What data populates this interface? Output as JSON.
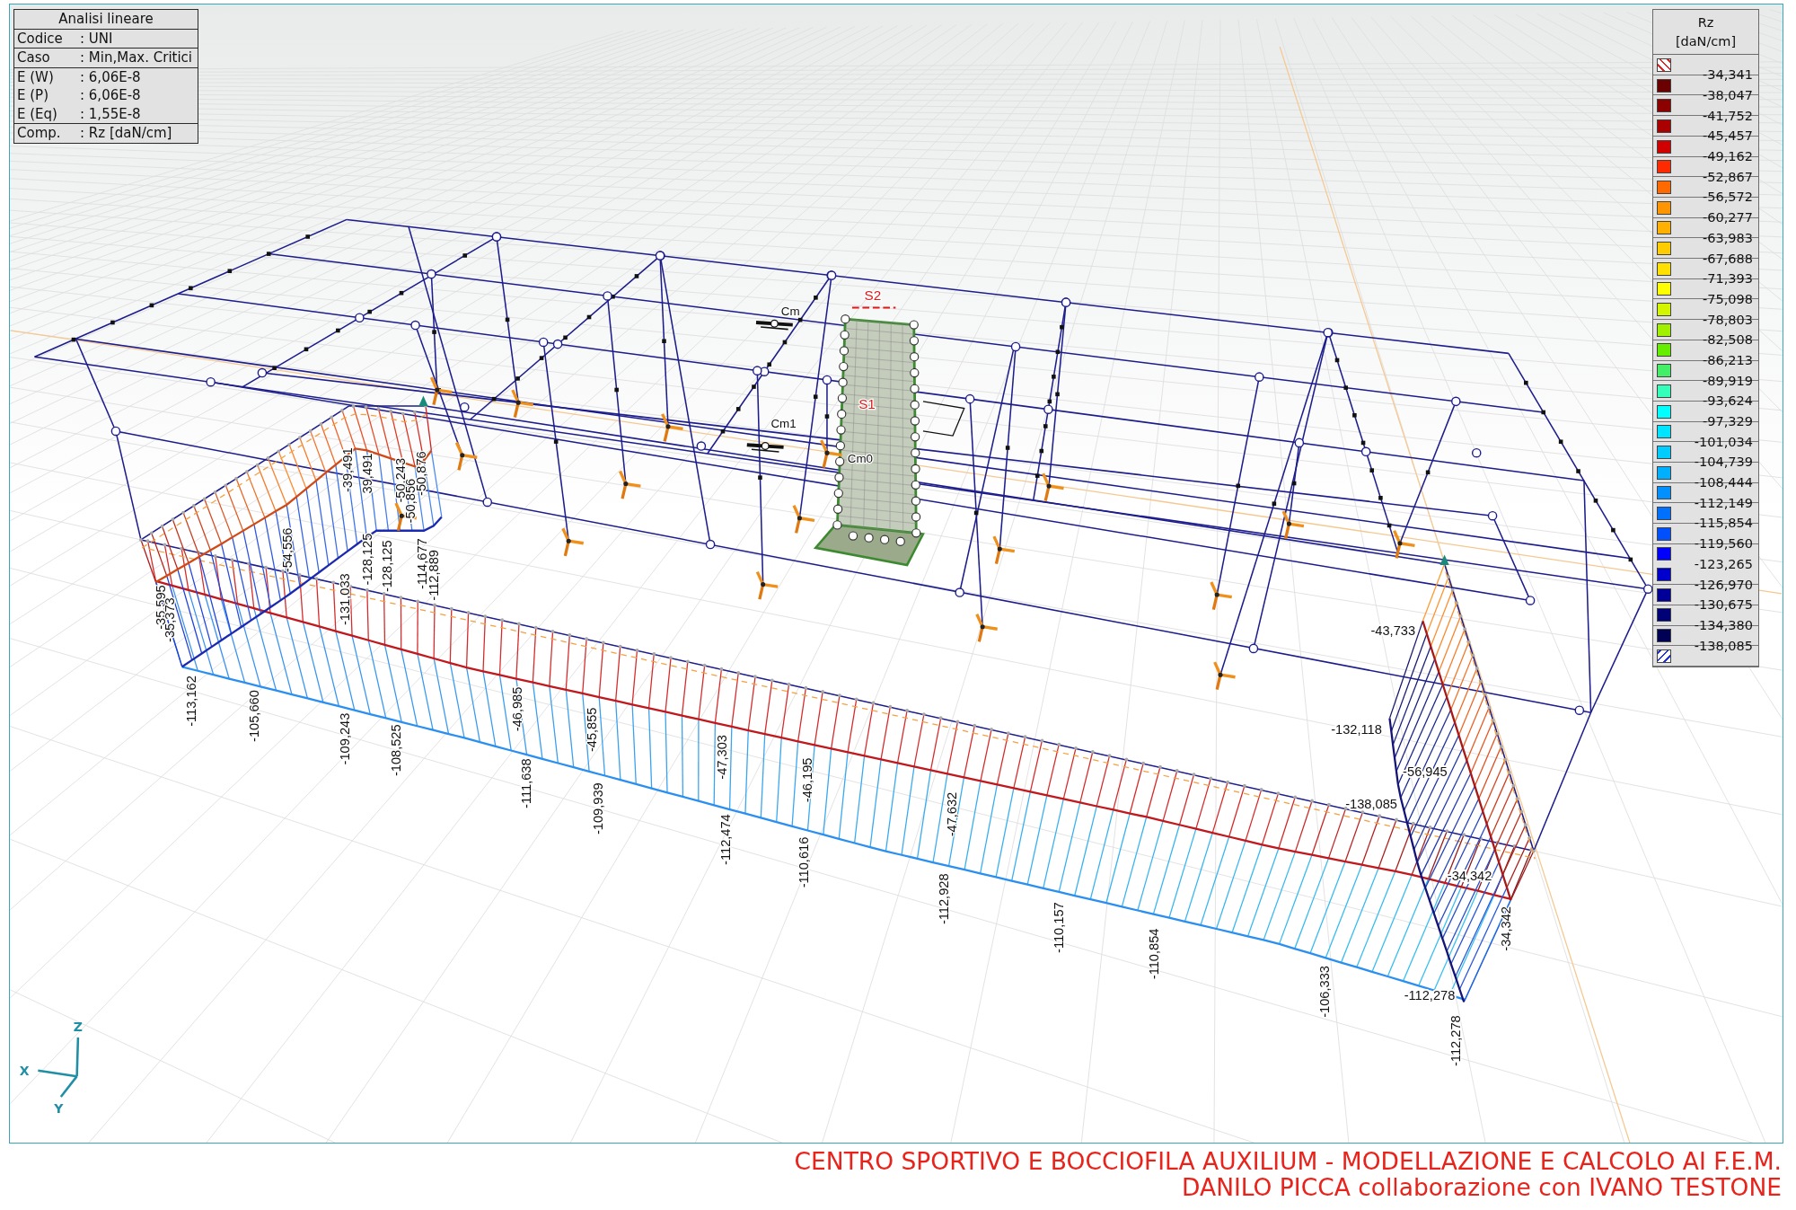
{
  "info_panel": {
    "title": "Analisi lineare",
    "sections": [
      [
        {
          "label": "Codice",
          "value": ": UNI"
        }
      ],
      [
        {
          "label": "Caso",
          "value": ": Min,Max. Critici"
        }
      ],
      [
        {
          "label": "E (W)",
          "value": ": 6,06E-8"
        },
        {
          "label": "E (P)",
          "value": ": 6,06E-8"
        },
        {
          "label": "E (Eq)",
          "value": ": 1,55E-8"
        }
      ],
      [
        {
          "label": "Comp.",
          "value": ": Rz [daN/cm]"
        }
      ]
    ]
  },
  "legend": {
    "title": "Rz",
    "unit": "[daN/cm]",
    "swatches": [
      {
        "kind": "hatch",
        "color": "#e02424"
      },
      {
        "kind": "solid",
        "color": "#6b0000"
      },
      {
        "kind": "solid",
        "color": "#8c0000"
      },
      {
        "kind": "solid",
        "color": "#aa0000"
      },
      {
        "kind": "solid",
        "color": "#d00000"
      },
      {
        "kind": "solid",
        "color": "#ff2a00"
      },
      {
        "kind": "solid",
        "color": "#ff6a00"
      },
      {
        "kind": "solid",
        "color": "#ff9500"
      },
      {
        "kind": "solid",
        "color": "#ffb000"
      },
      {
        "kind": "solid",
        "color": "#ffcc00"
      },
      {
        "kind": "solid",
        "color": "#ffe000"
      },
      {
        "kind": "solid",
        "color": "#ffff00"
      },
      {
        "kind": "solid",
        "color": "#d4f500"
      },
      {
        "kind": "solid",
        "color": "#a0f000"
      },
      {
        "kind": "solid",
        "color": "#66ee00"
      },
      {
        "kind": "solid",
        "color": "#44ee66"
      },
      {
        "kind": "solid",
        "color": "#33ffbb"
      },
      {
        "kind": "solid",
        "color": "#00ffff"
      },
      {
        "kind": "solid",
        "color": "#00e5ff"
      },
      {
        "kind": "solid",
        "color": "#00ccff"
      },
      {
        "kind": "solid",
        "color": "#00b0ff"
      },
      {
        "kind": "solid",
        "color": "#0090ff"
      },
      {
        "kind": "solid",
        "color": "#0070ff"
      },
      {
        "kind": "solid",
        "color": "#0050ff"
      },
      {
        "kind": "solid",
        "color": "#0000ff"
      },
      {
        "kind": "solid",
        "color": "#0000cc"
      },
      {
        "kind": "solid",
        "color": "#000099"
      },
      {
        "kind": "solid",
        "color": "#000077"
      },
      {
        "kind": "solid",
        "color": "#000055"
      },
      {
        "kind": "hatch",
        "color": "#2030e0"
      }
    ],
    "values": [
      "-34,341",
      "-38,047",
      "-41,752",
      "-45,457",
      "-49,162",
      "-52,867",
      "-56,572",
      "-60,277",
      "-63,983",
      "-67,688",
      "-71,393",
      "-75,098",
      "-78,803",
      "-82,508",
      "-86,213",
      "-89,919",
      "-93,624",
      "-97,329",
      "-101,034",
      "-104,739",
      "-108,444",
      "-112,149",
      "-115,854",
      "-119,560",
      "-123,265",
      "-126,970",
      "-130,675",
      "-134,380",
      "-138,085"
    ]
  },
  "model_view": {
    "tags": [
      {
        "text": "S2",
        "kind": "section"
      },
      {
        "text": "Cm",
        "kind": "node"
      },
      {
        "text": "S1",
        "kind": "section"
      },
      {
        "text": "Cm1",
        "kind": "node"
      },
      {
        "text": "Cm0",
        "kind": "node"
      }
    ],
    "value_labels": [
      {
        "text": "-35,595",
        "kind": "vertical"
      },
      {
        "text": "-35,373",
        "kind": "vertical"
      },
      {
        "text": "-113,162",
        "kind": "vertical"
      },
      {
        "text": "-54,556",
        "kind": "vertical"
      },
      {
        "text": "-105,660",
        "kind": "vertical"
      },
      {
        "text": "-131,033",
        "kind": "vertical"
      },
      {
        "text": "-109,243",
        "kind": "vertical"
      },
      {
        "text": "-39,491",
        "kind": "vertical"
      },
      {
        "text": "39,491",
        "kind": "vertical"
      },
      {
        "text": "-128,125",
        "kind": "vertical"
      },
      {
        "text": "-128,125",
        "kind": "vertical"
      },
      {
        "text": "-108,525",
        "kind": "vertical"
      },
      {
        "text": "-50,243",
        "kind": "vertical"
      },
      {
        "text": "-50,856",
        "kind": "vertical"
      },
      {
        "text": "-50,876",
        "kind": "vertical"
      },
      {
        "text": "-114,677",
        "kind": "vertical"
      },
      {
        "text": "-112,889",
        "kind": "vertical"
      },
      {
        "text": "-46,985",
        "kind": "vertical"
      },
      {
        "text": "-111,638",
        "kind": "vertical"
      },
      {
        "text": "-45,855",
        "kind": "vertical"
      },
      {
        "text": "-109,939",
        "kind": "vertical"
      },
      {
        "text": "-47,303",
        "kind": "vertical"
      },
      {
        "text": "-112,474",
        "kind": "vertical"
      },
      {
        "text": "-46,195",
        "kind": "vertical"
      },
      {
        "text": "-110,616",
        "kind": "vertical"
      },
      {
        "text": "-47,632",
        "kind": "vertical"
      },
      {
        "text": "-112,928",
        "kind": "vertical"
      },
      {
        "text": "-110,157",
        "kind": "vertical"
      },
      {
        "text": "-110,854",
        "kind": "vertical"
      },
      {
        "text": "-106,333",
        "kind": "vertical"
      },
      {
        "text": "-43,733",
        "kind": "horizontal"
      },
      {
        "text": "-132,118",
        "kind": "horizontal"
      },
      {
        "text": "-56,945",
        "kind": "horizontal"
      },
      {
        "text": "-138,085",
        "kind": "horizontal"
      },
      {
        "text": "-34,342",
        "kind": "horizontal"
      },
      {
        "text": "-34,342",
        "kind": "vertical"
      },
      {
        "text": "-112,278",
        "kind": "horizontal"
      },
      {
        "text": "-112,278",
        "kind": "vertical"
      }
    ]
  },
  "axes": [
    {
      "text": "Z",
      "kind": "z"
    },
    {
      "text": "X",
      "kind": "x"
    },
    {
      "text": "Y",
      "kind": "y"
    }
  ],
  "footer": {
    "title": "CENTRO SPORTIVO E BOCCIOFILA AUXILIUM - MODELLAZIONE E CALCOLO AI F.E.M.",
    "credits": "DANILO PICCA collaborazione con IVANO TESTONE"
  }
}
